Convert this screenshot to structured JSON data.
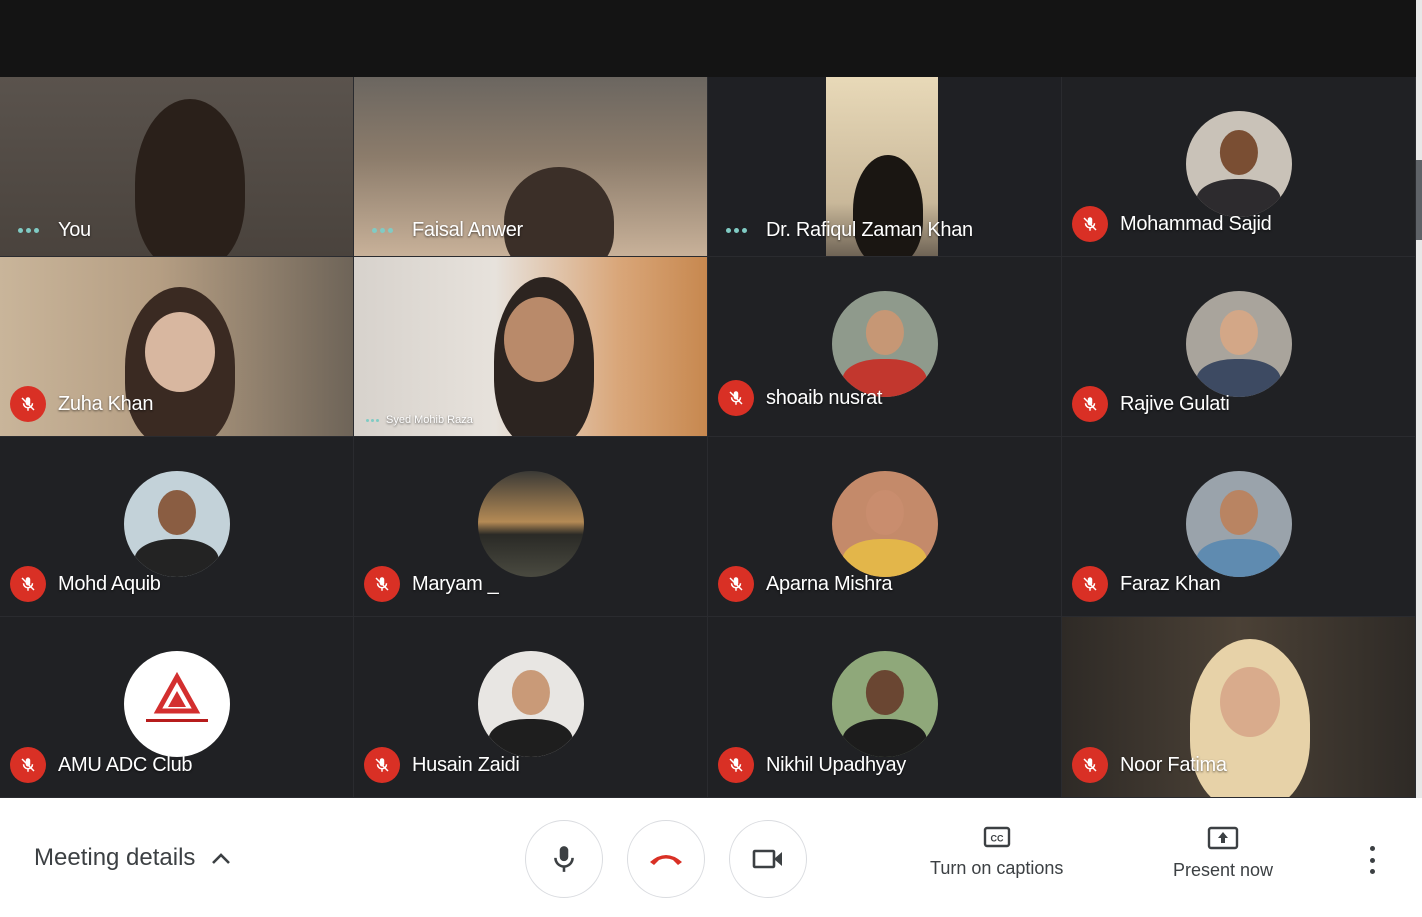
{
  "participants": [
    {
      "name": "You",
      "kind": "video",
      "status": "speaking"
    },
    {
      "name": "Faisal Anwer",
      "kind": "video",
      "status": "speaking"
    },
    {
      "name": "Dr. Rafiqul Zaman Khan",
      "kind": "video",
      "status": "speaking"
    },
    {
      "name": "Mohammad Sajid",
      "kind": "avatar",
      "status": "muted"
    },
    {
      "name": "Zuha Khan",
      "kind": "video",
      "status": "muted"
    },
    {
      "name": "Syed Mohib Raza",
      "kind": "video",
      "status": "speaking"
    },
    {
      "name": "shoaib nusrat",
      "kind": "avatar",
      "status": "muted"
    },
    {
      "name": "Rajive Gulati",
      "kind": "avatar",
      "status": "muted"
    },
    {
      "name": "Mohd Aquib",
      "kind": "avatar",
      "status": "muted"
    },
    {
      "name": "Maryam _",
      "kind": "avatar",
      "status": "muted"
    },
    {
      "name": "Aparna Mishra",
      "kind": "avatar",
      "status": "muted"
    },
    {
      "name": "Faraz Khan",
      "kind": "avatar",
      "status": "muted"
    },
    {
      "name": "AMU ADC Club",
      "kind": "avatar",
      "status": "muted"
    },
    {
      "name": "Husain Zaidi",
      "kind": "avatar",
      "status": "muted"
    },
    {
      "name": "Nikhil Upadhyay",
      "kind": "avatar",
      "status": "muted"
    },
    {
      "name": "Noor Fatima",
      "kind": "video",
      "status": "muted"
    }
  ],
  "toolbar": {
    "meeting_details": "Meeting details",
    "captions": "Turn on captions",
    "present": "Present now"
  },
  "colors": {
    "grid_bg": "#202124",
    "muted_red": "#d93025",
    "speaking_dots": "#80cbc4",
    "hangup_red": "#d93025"
  }
}
